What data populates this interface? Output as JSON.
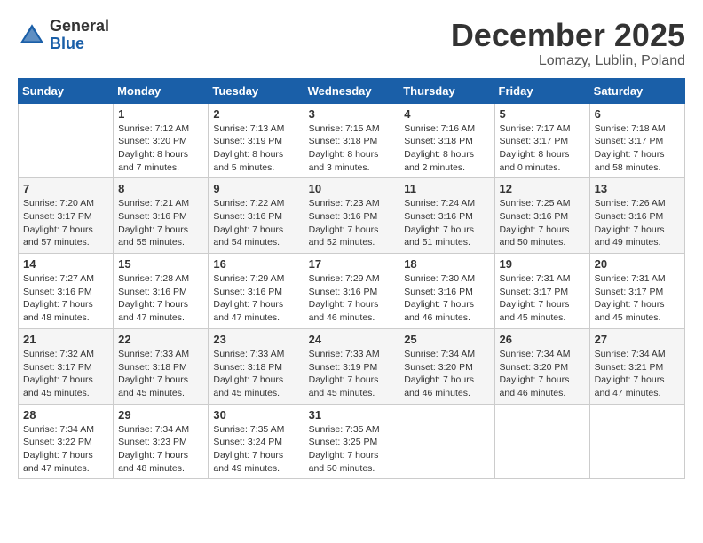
{
  "header": {
    "logo_general": "General",
    "logo_blue": "Blue",
    "month_title": "December 2025",
    "location": "Lomazy, Lublin, Poland"
  },
  "weekdays": [
    "Sunday",
    "Monday",
    "Tuesday",
    "Wednesday",
    "Thursday",
    "Friday",
    "Saturday"
  ],
  "weeks": [
    [
      {
        "day": "",
        "info": ""
      },
      {
        "day": "1",
        "info": "Sunrise: 7:12 AM\nSunset: 3:20 PM\nDaylight: 8 hours\nand 7 minutes."
      },
      {
        "day": "2",
        "info": "Sunrise: 7:13 AM\nSunset: 3:19 PM\nDaylight: 8 hours\nand 5 minutes."
      },
      {
        "day": "3",
        "info": "Sunrise: 7:15 AM\nSunset: 3:18 PM\nDaylight: 8 hours\nand 3 minutes."
      },
      {
        "day": "4",
        "info": "Sunrise: 7:16 AM\nSunset: 3:18 PM\nDaylight: 8 hours\nand 2 minutes."
      },
      {
        "day": "5",
        "info": "Sunrise: 7:17 AM\nSunset: 3:17 PM\nDaylight: 8 hours\nand 0 minutes."
      },
      {
        "day": "6",
        "info": "Sunrise: 7:18 AM\nSunset: 3:17 PM\nDaylight: 7 hours\nand 58 minutes."
      }
    ],
    [
      {
        "day": "7",
        "info": "Sunrise: 7:20 AM\nSunset: 3:17 PM\nDaylight: 7 hours\nand 57 minutes."
      },
      {
        "day": "8",
        "info": "Sunrise: 7:21 AM\nSunset: 3:16 PM\nDaylight: 7 hours\nand 55 minutes."
      },
      {
        "day": "9",
        "info": "Sunrise: 7:22 AM\nSunset: 3:16 PM\nDaylight: 7 hours\nand 54 minutes."
      },
      {
        "day": "10",
        "info": "Sunrise: 7:23 AM\nSunset: 3:16 PM\nDaylight: 7 hours\nand 52 minutes."
      },
      {
        "day": "11",
        "info": "Sunrise: 7:24 AM\nSunset: 3:16 PM\nDaylight: 7 hours\nand 51 minutes."
      },
      {
        "day": "12",
        "info": "Sunrise: 7:25 AM\nSunset: 3:16 PM\nDaylight: 7 hours\nand 50 minutes."
      },
      {
        "day": "13",
        "info": "Sunrise: 7:26 AM\nSunset: 3:16 PM\nDaylight: 7 hours\nand 49 minutes."
      }
    ],
    [
      {
        "day": "14",
        "info": "Sunrise: 7:27 AM\nSunset: 3:16 PM\nDaylight: 7 hours\nand 48 minutes."
      },
      {
        "day": "15",
        "info": "Sunrise: 7:28 AM\nSunset: 3:16 PM\nDaylight: 7 hours\nand 47 minutes."
      },
      {
        "day": "16",
        "info": "Sunrise: 7:29 AM\nSunset: 3:16 PM\nDaylight: 7 hours\nand 47 minutes."
      },
      {
        "day": "17",
        "info": "Sunrise: 7:29 AM\nSunset: 3:16 PM\nDaylight: 7 hours\nand 46 minutes."
      },
      {
        "day": "18",
        "info": "Sunrise: 7:30 AM\nSunset: 3:16 PM\nDaylight: 7 hours\nand 46 minutes."
      },
      {
        "day": "19",
        "info": "Sunrise: 7:31 AM\nSunset: 3:17 PM\nDaylight: 7 hours\nand 45 minutes."
      },
      {
        "day": "20",
        "info": "Sunrise: 7:31 AM\nSunset: 3:17 PM\nDaylight: 7 hours\nand 45 minutes."
      }
    ],
    [
      {
        "day": "21",
        "info": "Sunrise: 7:32 AM\nSunset: 3:17 PM\nDaylight: 7 hours\nand 45 minutes."
      },
      {
        "day": "22",
        "info": "Sunrise: 7:33 AM\nSunset: 3:18 PM\nDaylight: 7 hours\nand 45 minutes."
      },
      {
        "day": "23",
        "info": "Sunrise: 7:33 AM\nSunset: 3:18 PM\nDaylight: 7 hours\nand 45 minutes."
      },
      {
        "day": "24",
        "info": "Sunrise: 7:33 AM\nSunset: 3:19 PM\nDaylight: 7 hours\nand 45 minutes."
      },
      {
        "day": "25",
        "info": "Sunrise: 7:34 AM\nSunset: 3:20 PM\nDaylight: 7 hours\nand 46 minutes."
      },
      {
        "day": "26",
        "info": "Sunrise: 7:34 AM\nSunset: 3:20 PM\nDaylight: 7 hours\nand 46 minutes."
      },
      {
        "day": "27",
        "info": "Sunrise: 7:34 AM\nSunset: 3:21 PM\nDaylight: 7 hours\nand 47 minutes."
      }
    ],
    [
      {
        "day": "28",
        "info": "Sunrise: 7:34 AM\nSunset: 3:22 PM\nDaylight: 7 hours\nand 47 minutes."
      },
      {
        "day": "29",
        "info": "Sunrise: 7:34 AM\nSunset: 3:23 PM\nDaylight: 7 hours\nand 48 minutes."
      },
      {
        "day": "30",
        "info": "Sunrise: 7:35 AM\nSunset: 3:24 PM\nDaylight: 7 hours\nand 49 minutes."
      },
      {
        "day": "31",
        "info": "Sunrise: 7:35 AM\nSunset: 3:25 PM\nDaylight: 7 hours\nand 50 minutes."
      },
      {
        "day": "",
        "info": ""
      },
      {
        "day": "",
        "info": ""
      },
      {
        "day": "",
        "info": ""
      }
    ]
  ]
}
